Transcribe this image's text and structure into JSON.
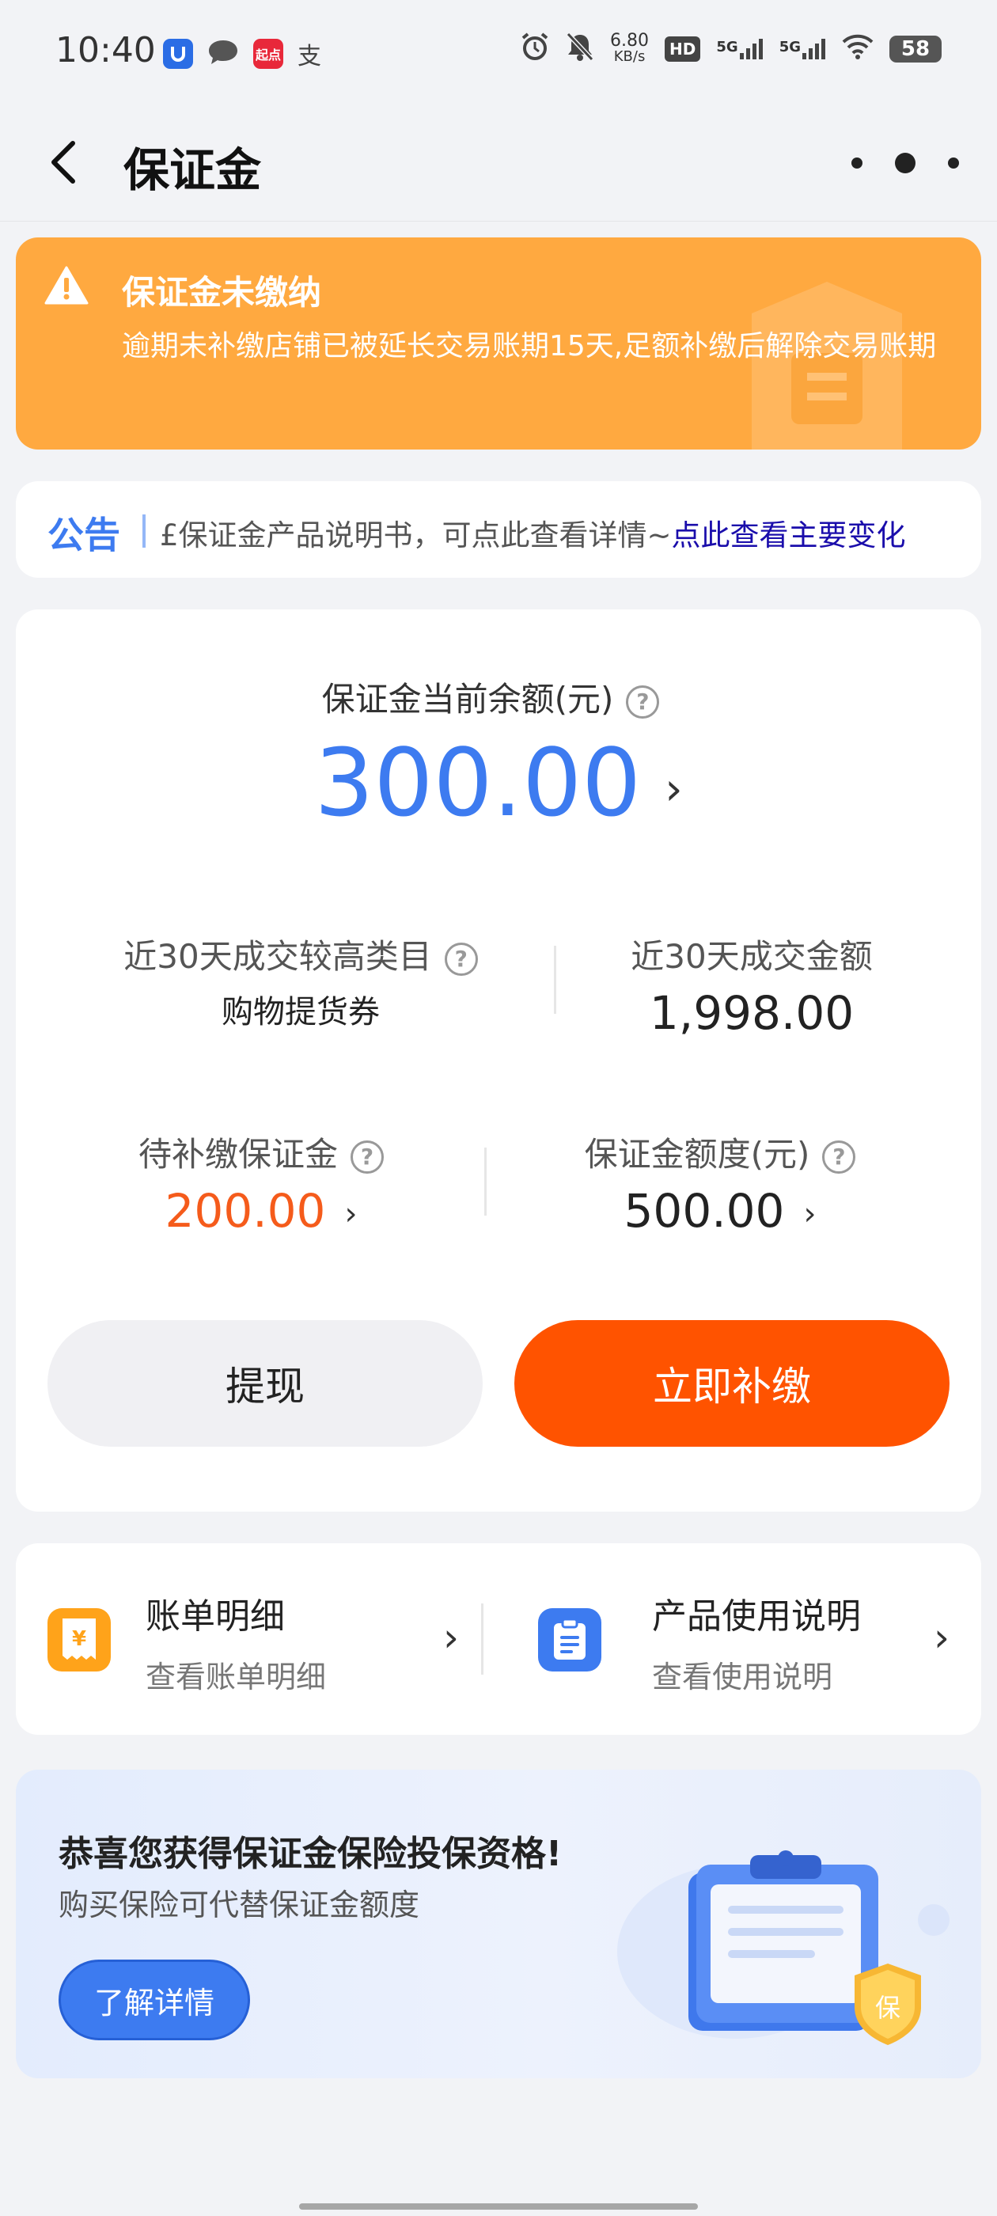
{
  "status_bar": {
    "time": "10:40",
    "app_icons": [
      "u-app-icon",
      "message-icon",
      "qidian-app-icon",
      "alipay-icon"
    ],
    "qidian_label": "起点",
    "alipay_label": "支",
    "net_speed_value": "6.80",
    "net_speed_unit": "KB/s",
    "hd_label": "HD",
    "sim1_label": "5G",
    "sim2_label": "5G",
    "battery": "58"
  },
  "nav": {
    "title": "保证金",
    "back_icon": "chevron-left-icon",
    "more_icon": "more-dots-icon"
  },
  "warning": {
    "title": "保证金未缴纳",
    "description": "逾期未补缴店铺已被延长交易账期15天,足额补缴后解除交易账期",
    "color": "#ffa940"
  },
  "notice": {
    "tag": "公告",
    "text": "£保证金产品说明书，可点此查看详情~",
    "link_text": "点此查看主要变化"
  },
  "balance": {
    "label": "保证金当前余额(元)",
    "amount": "300.00",
    "accent_color": "#3d7bf0"
  },
  "stats": {
    "top_category_label": "近30天成交较高类目",
    "top_category_value": "购物提货券",
    "deal_amount_label": "近30天成交金额",
    "deal_amount_value": "1,998.00",
    "pending_label": "待补缴保证金",
    "pending_value": "200.00",
    "quota_label": "保证金额度(元)",
    "quota_value": "500.00"
  },
  "actions": {
    "withdraw_label": "提现",
    "pay_label": "立即补缴",
    "pay_color": "#ff5300"
  },
  "links": [
    {
      "title": "账单明细",
      "subtitle": "查看账单明细",
      "icon": "bill-yuan-icon",
      "icon_glyph": "¥"
    },
    {
      "title": "产品使用说明",
      "subtitle": "查看使用说明",
      "icon": "document-icon"
    }
  ],
  "insurance": {
    "title": "恭喜您获得保证金保险投保资格!",
    "subtitle": "购买保险可代替保证金额度",
    "button_label": "了解详情",
    "shield_label": "保"
  }
}
